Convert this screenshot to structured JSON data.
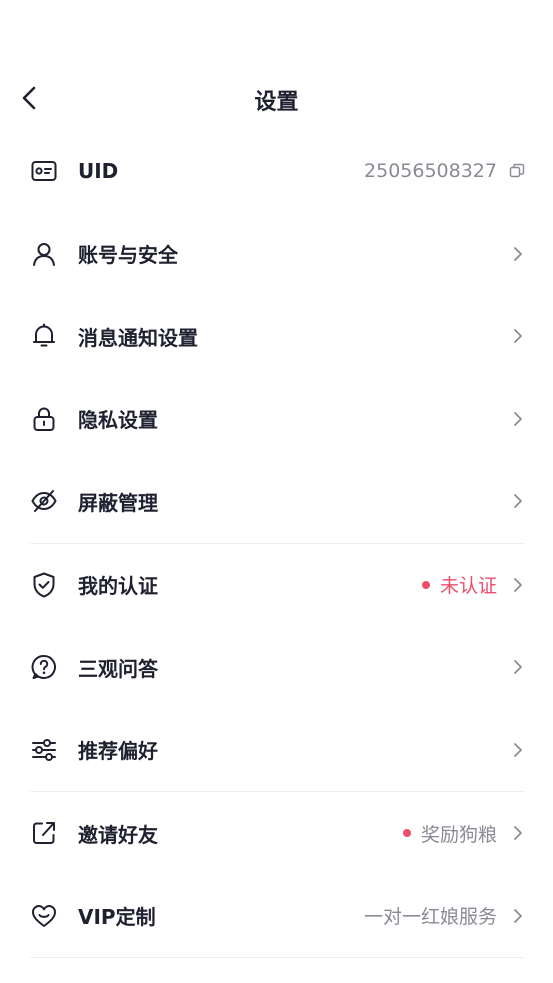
{
  "header": {
    "title": "设置"
  },
  "rows": [
    {
      "key": "uid",
      "icon": "id-card-icon",
      "label": "UID",
      "value": "25056508327",
      "value_icon": "copy-icon"
    },
    {
      "key": "account",
      "icon": "user-icon",
      "label": "账号与安全"
    },
    {
      "key": "notify",
      "icon": "bell-icon",
      "label": "消息通知设置"
    },
    {
      "key": "privacy",
      "icon": "lock-icon",
      "label": "隐私设置"
    },
    {
      "key": "block",
      "icon": "eye-off-icon",
      "label": "屏蔽管理"
    },
    {
      "key": "verify",
      "icon": "shield-check-icon",
      "label": "我的认证",
      "value": "未认证",
      "badge": "red-dot"
    },
    {
      "key": "qa",
      "icon": "question-icon",
      "label": "三观问答"
    },
    {
      "key": "prefs",
      "icon": "sliders-icon",
      "label": "推荐偏好"
    },
    {
      "key": "invite",
      "icon": "share-icon",
      "label": "邀请好友",
      "value": "奖励狗粮",
      "badge": "red-dot"
    },
    {
      "key": "vip",
      "icon": "heart-icon",
      "label": "VIP定制",
      "value": "一对一红娘服务"
    }
  ],
  "colors": {
    "text": "#1f2030",
    "muted": "#8a8b94",
    "accent": "#ee4d6a",
    "divider": "#efeff2"
  }
}
